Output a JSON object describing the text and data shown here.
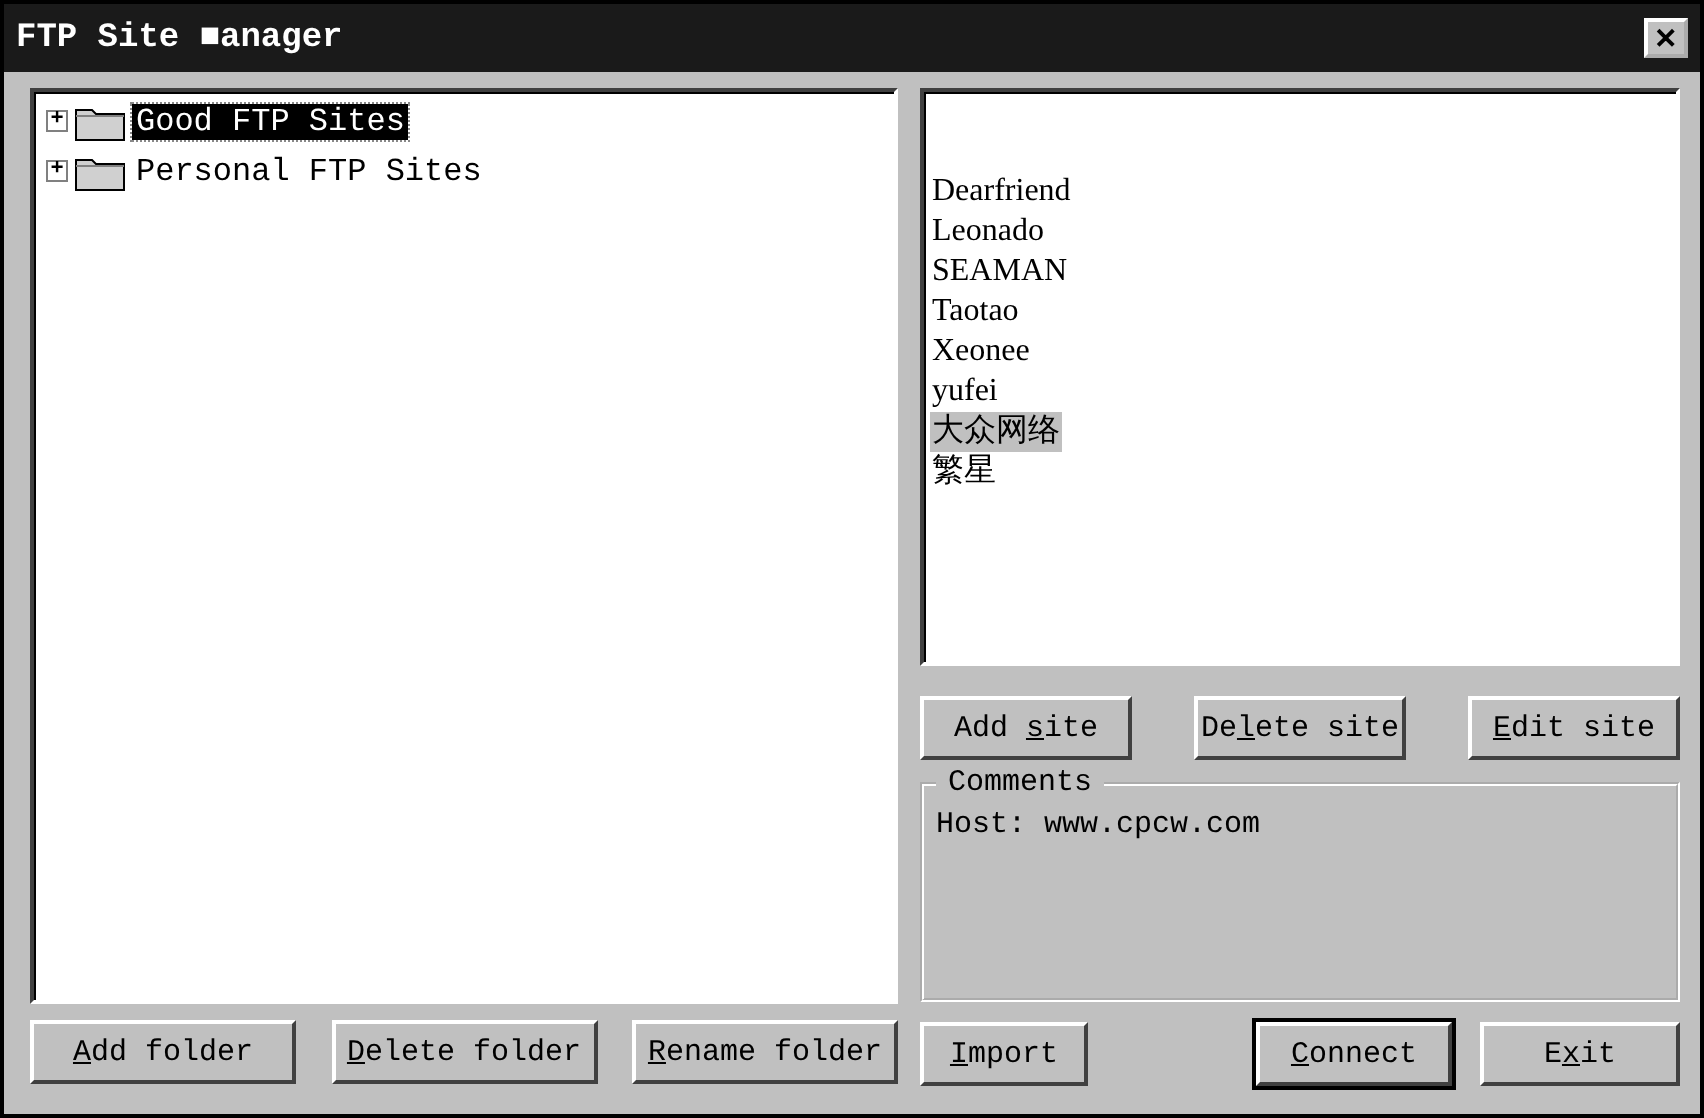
{
  "window": {
    "title": "FTP Site ■anager",
    "close": "✕"
  },
  "tree": [
    {
      "label": "Good FTP Sites",
      "expanded": false,
      "selected": true,
      "expander": "+"
    },
    {
      "label": "Personal FTP Sites",
      "expanded": false,
      "selected": false,
      "expander": "+"
    }
  ],
  "sites": [
    {
      "label": "Dearfriend",
      "selected": false
    },
    {
      "label": "Leonado",
      "selected": false
    },
    {
      "label": "SEAMAN",
      "selected": false
    },
    {
      "label": "Taotao",
      "selected": false
    },
    {
      "label": "Xeonee",
      "selected": false
    },
    {
      "label": "yufei",
      "selected": false
    },
    {
      "label": "大众网络",
      "selected": true
    },
    {
      "label": "繁星",
      "selected": false
    }
  ],
  "site_buttons": [
    {
      "before": "Add ",
      "key": "s",
      "after": "ite",
      "default": false
    },
    {
      "before": "De",
      "key": "l",
      "after": "ete site",
      "default": false
    },
    {
      "key": "E",
      "after": "dit site",
      "default": false
    }
  ],
  "comments": {
    "legend": "Comments",
    "text": "Host: www.cpcw.com"
  },
  "folder_buttons": [
    {
      "key": "A",
      "after": "dd folder",
      "default": false
    },
    {
      "key": "D",
      "after": "elete folder",
      "default": false
    },
    {
      "key": "R",
      "after": "ename folder",
      "default": false
    }
  ],
  "dialog_buttons": [
    {
      "key": "I",
      "after": "mport",
      "default": false
    },
    {
      "key": "C",
      "after": "onnect",
      "default": true
    },
    {
      "before": "E",
      "key": "x",
      "after": "it",
      "default": false
    }
  ]
}
